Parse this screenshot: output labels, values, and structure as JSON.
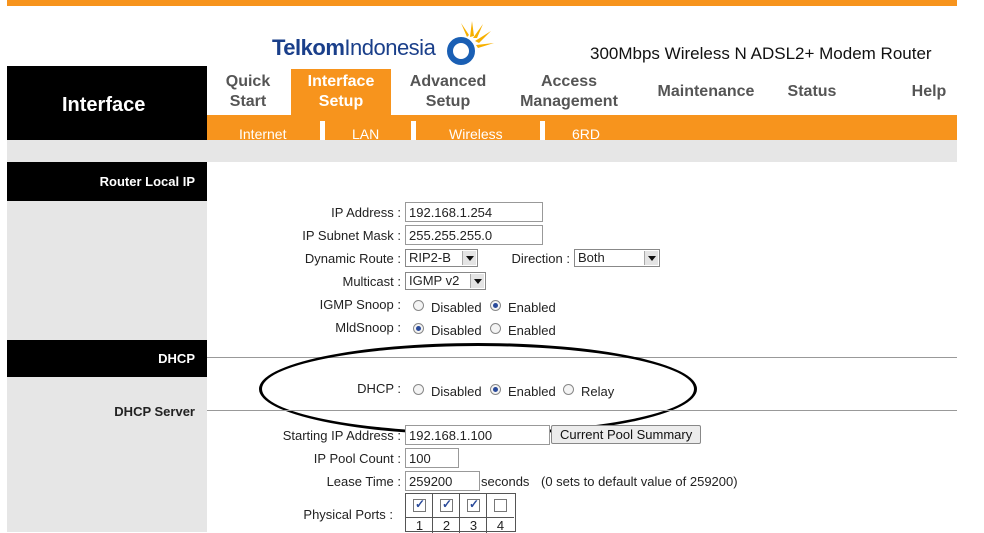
{
  "brand": {
    "logo_word1": "Telkom",
    "logo_word2": "Indonesia",
    "product_name": "300Mbps Wireless N ADSL2+ Modem Router",
    "accent_color": "#f7941d",
    "logo_icon": "sun-ring-icon"
  },
  "nav": {
    "section_title": "Interface",
    "tabs": [
      {
        "line1": "Quick",
        "line2": "Start"
      },
      {
        "line1": "Interface",
        "line2": "Setup",
        "active": true
      },
      {
        "line1": "Advanced",
        "line2": "Setup"
      },
      {
        "line1": "Access",
        "line2": "Management"
      },
      {
        "line1": "Maintenance",
        "line2": ""
      },
      {
        "line1": "Status",
        "line2": ""
      },
      {
        "line1": "Help",
        "line2": ""
      }
    ],
    "subtabs": [
      "Internet",
      "LAN",
      "Wireless",
      "6RD"
    ]
  },
  "router_local_ip": {
    "heading": "Router Local IP",
    "ip_address_label": "IP Address :",
    "ip_address": "192.168.1.254",
    "subnet_label": "IP Subnet Mask :",
    "subnet": "255.255.255.0",
    "dynamic_route_label": "Dynamic Route :",
    "dynamic_route": "RIP2-B",
    "direction_label": "Direction :",
    "direction": "Both",
    "multicast_label": "Multicast :",
    "multicast": "IGMP v2",
    "igmp_snoop_label": "IGMP Snoop :",
    "mld_snoop_label": "MldSnoop :",
    "opt_disabled": "Disabled",
    "opt_enabled": "Enabled",
    "igmp_snoop_value": "Enabled",
    "mld_snoop_value": "Disabled"
  },
  "dhcp": {
    "heading": "DHCP",
    "dhcp_label": "DHCP :",
    "opt_disabled": "Disabled",
    "opt_enabled": "Enabled",
    "opt_relay": "Relay",
    "value": "Enabled"
  },
  "dhcp_server": {
    "heading": "DHCP Server",
    "start_ip_label": "Starting IP Address :",
    "start_ip": "192.168.1.100",
    "pool_summary_button": "Current Pool Summary",
    "pool_count_label": "IP Pool Count :",
    "pool_count": "100",
    "lease_label": "Lease Time :",
    "lease_time": "259200",
    "lease_unit": "seconds",
    "lease_hint": "(0 sets to default value of 259200)",
    "ports_label": "Physical Ports :",
    "ports": [
      {
        "num": "1",
        "checked": true
      },
      {
        "num": "2",
        "checked": true
      },
      {
        "num": "3",
        "checked": true
      },
      {
        "num": "4",
        "checked": false
      }
    ]
  }
}
